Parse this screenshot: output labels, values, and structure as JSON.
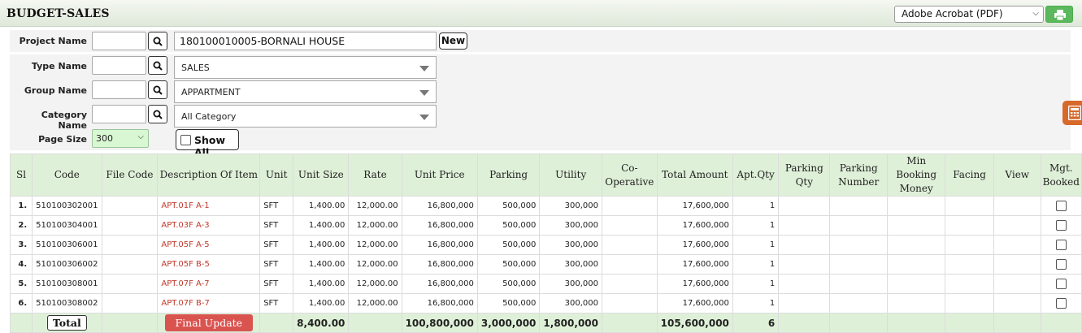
{
  "header": {
    "title": "BUDGET-SALES",
    "export_format": "Adobe Acrobat (PDF)",
    "print_icon": "printer-icon"
  },
  "filters": {
    "project": {
      "label": "Project Name",
      "code": "",
      "value": "180100010005-BORNALI HOUSE",
      "new_label": "New"
    },
    "type": {
      "label": "Type Name",
      "code": "",
      "value": "SALES"
    },
    "group": {
      "label": "Group Name",
      "code": "",
      "value": "APPARTMENT"
    },
    "category": {
      "label": "Category Name",
      "code": "",
      "value": "All Category"
    },
    "page_size": {
      "label": "Page Size",
      "value": "300"
    },
    "show_all_label": "Show All"
  },
  "table": {
    "columns": [
      "Sl",
      "Code",
      "File Code",
      "Description Of Item",
      "Unit",
      "Unit Size",
      "Rate",
      "Unit Price",
      "Parking",
      "Utility",
      "Co-Operative",
      "Total Amount",
      "Apt.Qty",
      "Parking Qty",
      "Parking Number",
      "Min Booking Money",
      "Facing",
      "View",
      "Mgt. Booked"
    ],
    "rows": [
      {
        "sl": "1.",
        "code": "510100302001",
        "file_code": "",
        "desc": "APT.01F A-1",
        "unit": "SFT",
        "unit_size": "1,400.00",
        "rate": "12,000.00",
        "unit_price": "16,800,000",
        "parking": "500,000",
        "utility": "300,000",
        "coop": "",
        "total": "17,600,000",
        "qty": "1",
        "pqty": "",
        "pnum": "",
        "minbook": "",
        "facing": "",
        "view": ""
      },
      {
        "sl": "2.",
        "code": "510100304001",
        "file_code": "",
        "desc": "APT.03F A-3",
        "unit": "SFT",
        "unit_size": "1,400.00",
        "rate": "12,000.00",
        "unit_price": "16,800,000",
        "parking": "500,000",
        "utility": "300,000",
        "coop": "",
        "total": "17,600,000",
        "qty": "1",
        "pqty": "",
        "pnum": "",
        "minbook": "",
        "facing": "",
        "view": ""
      },
      {
        "sl": "3.",
        "code": "510100306001",
        "file_code": "",
        "desc": "APT.05F A-5",
        "unit": "SFT",
        "unit_size": "1,400.00",
        "rate": "12,000.00",
        "unit_price": "16,800,000",
        "parking": "500,000",
        "utility": "300,000",
        "coop": "",
        "total": "17,600,000",
        "qty": "1",
        "pqty": "",
        "pnum": "",
        "minbook": "",
        "facing": "",
        "view": ""
      },
      {
        "sl": "4.",
        "code": "510100306002",
        "file_code": "",
        "desc": "APT.05F B-5",
        "unit": "SFT",
        "unit_size": "1,400.00",
        "rate": "12,000.00",
        "unit_price": "16,800,000",
        "parking": "500,000",
        "utility": "300,000",
        "coop": "",
        "total": "17,600,000",
        "qty": "1",
        "pqty": "",
        "pnum": "",
        "minbook": "",
        "facing": "",
        "view": ""
      },
      {
        "sl": "5.",
        "code": "510100308001",
        "file_code": "",
        "desc": "APT.07F A-7",
        "unit": "SFT",
        "unit_size": "1,400.00",
        "rate": "12,000.00",
        "unit_price": "16,800,000",
        "parking": "500,000",
        "utility": "300,000",
        "coop": "",
        "total": "17,600,000",
        "qty": "1",
        "pqty": "",
        "pnum": "",
        "minbook": "",
        "facing": "",
        "view": ""
      },
      {
        "sl": "6.",
        "code": "510100308002",
        "file_code": "",
        "desc": "APT.07F B-7",
        "unit": "SFT",
        "unit_size": "1,400.00",
        "rate": "12,000.00",
        "unit_price": "16,800,000",
        "parking": "500,000",
        "utility": "300,000",
        "coop": "",
        "total": "17,600,000",
        "qty": "1",
        "pqty": "",
        "pnum": "",
        "minbook": "",
        "facing": "",
        "view": ""
      }
    ],
    "totals": {
      "label": "Total",
      "final_update_label": "Final Update",
      "unit_size": "8,400.00",
      "unit_price": "100,800,000",
      "parking": "3,000,000",
      "utility": "1,800,000",
      "total": "105,600,000",
      "qty": "6"
    }
  },
  "colors": {
    "header_green": "#dff0d8",
    "description_red": "#c0392b",
    "final_update_red": "#d9534f",
    "print_green": "#5cb85c",
    "calculator_orange": "#d7692a"
  }
}
